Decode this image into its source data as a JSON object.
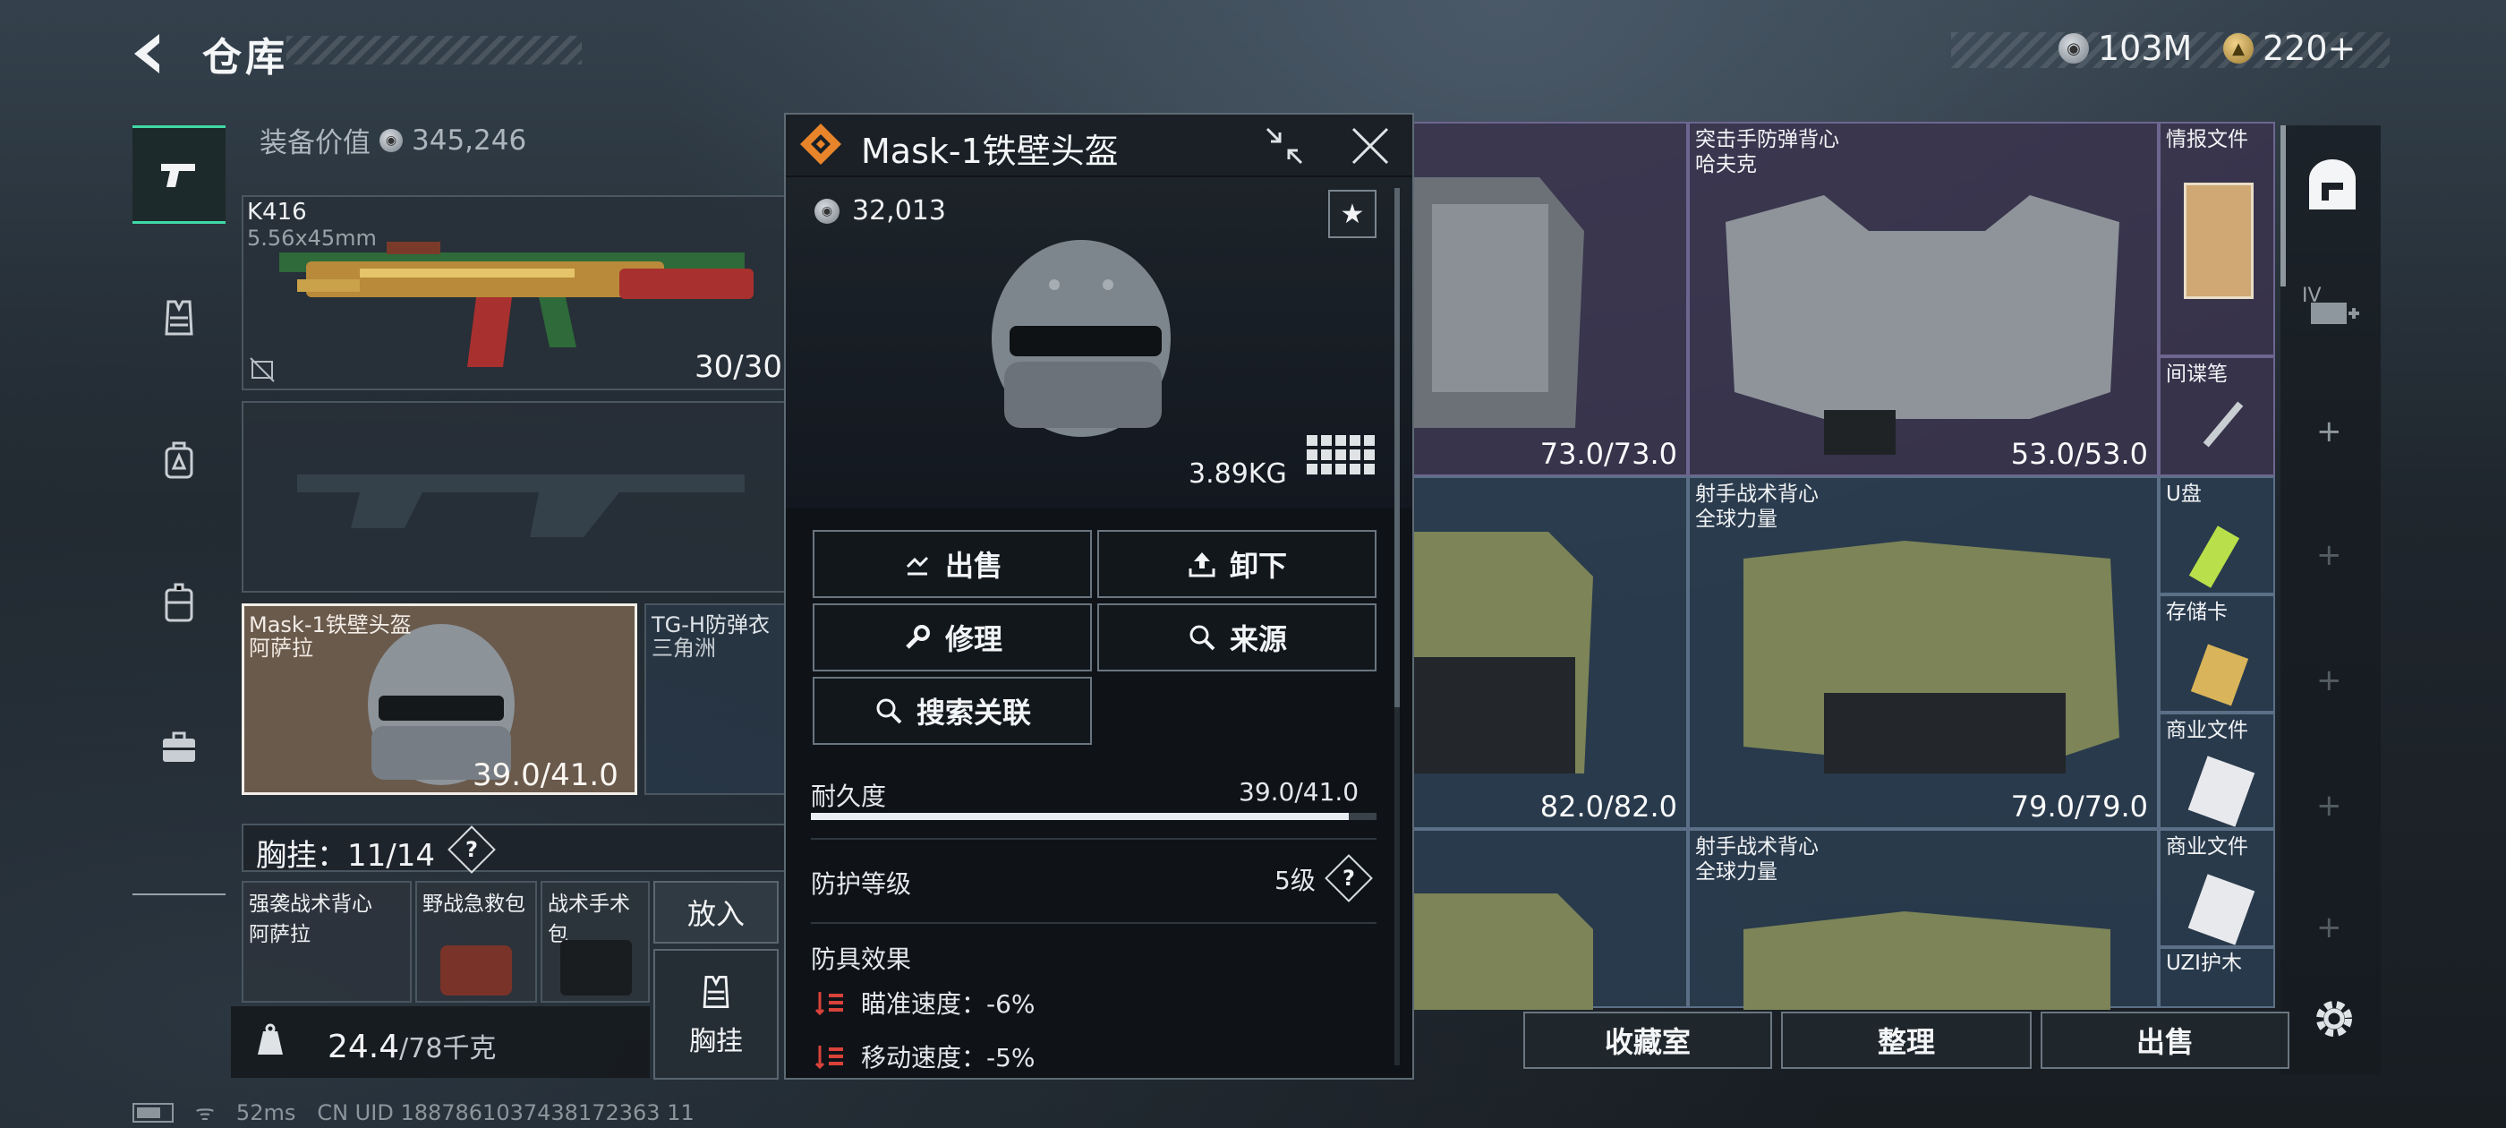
{
  "header": {
    "title": "仓库",
    "currency_silver": "103M",
    "currency_gold": "220+"
  },
  "loadout": {
    "equip_value_label": "装备价值",
    "equip_value": "345,246",
    "weapon": {
      "name": "K416",
      "caliber": "5.56x45mm",
      "ammo": "30/30"
    },
    "helmet": {
      "name": "Mask-1铁壁头盔",
      "map": "阿萨拉",
      "durability": "39.0/41.0"
    },
    "armor": {
      "name": "TG-H防弹衣",
      "map": "三角洲"
    },
    "chest_rig": {
      "label": "胸挂：11/14"
    },
    "sub_items": [
      {
        "name": "强袭战术背心",
        "map": "阿萨拉"
      },
      {
        "name": "野战急救包"
      },
      {
        "name": "战术手术包"
      }
    ],
    "put_in_label": "放入",
    "chest_button_label": "胸挂",
    "weight_value": "24.4",
    "weight_max": "/78千克"
  },
  "status": {
    "ping": "52ms",
    "uid": "CN UID 1887861037438172363 11"
  },
  "storage": {
    "items": [
      {
        "name": "",
        "map": "",
        "durability": "73.0/73.0"
      },
      {
        "name": "突击手防弹背心",
        "map": "哈夫克",
        "durability": "53.0/53.0"
      },
      {
        "name": "射手战术背心",
        "map": "全球力量",
        "durability": "79.0/79.0"
      },
      {
        "name": "",
        "map": "",
        "durability": "82.0/82.0"
      },
      {
        "name": "射手战术背心",
        "map": "全球力量",
        "durability": ""
      }
    ],
    "small_items": [
      "情报文件",
      "间谍笔",
      "U盘",
      "存储卡",
      "商业文件",
      "商业文件",
      "UZI护木"
    ],
    "side_tab_label": "IV",
    "buttons": {
      "collection": "收藏室",
      "organize": "整理",
      "sell": "出售"
    }
  },
  "popup": {
    "title": "Mask-1铁壁头盔",
    "value": "32,013",
    "weight": "3.89KG",
    "actions": {
      "sell": "出售",
      "unload": "卸下",
      "repair": "修理",
      "source": "来源",
      "search_related": "搜索关联"
    },
    "durability_label": "耐久度",
    "durability_value": "39.0/41.0",
    "durability_fraction": 0.951,
    "protection_label": "防护等级",
    "protection_value": "5级",
    "effects_title": "防具效果",
    "effects": [
      {
        "label": "瞄准速度：-6%"
      },
      {
        "label": "移动速度：-5%"
      }
    ]
  },
  "colors": {
    "accent": "#40d8a6",
    "rarity": "#e8852b",
    "selected_bg": "#6a5a4c"
  }
}
